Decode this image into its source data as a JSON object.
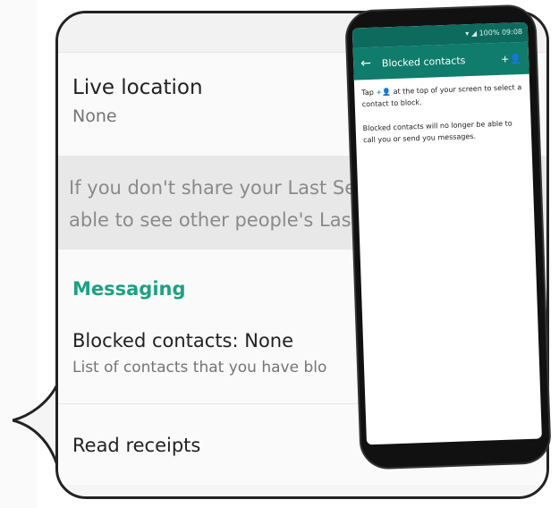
{
  "settings": {
    "live_location": {
      "title": "Live location",
      "value": "None"
    },
    "info_text": [
      "If you don't share your Last Se",
      "able to see other people's Las"
    ],
    "section_header": "Messaging",
    "blocked": {
      "title": "Blocked contacts: None",
      "subtitle": "List of contacts that you have blo"
    },
    "read_receipts": {
      "title": "Read receipts"
    }
  },
  "phone": {
    "status_text": "100%  09:08",
    "appbar": {
      "title": "Blocked contacts",
      "back_icon": "arrow-back-icon",
      "add_icon": "add-contact-icon"
    },
    "body": {
      "paragraph1_pre": "Tap",
      "paragraph1_post": "at the top of your screen to select a contact to block.",
      "paragraph2": "Blocked contacts will no longer be able to call you or send you messages."
    }
  },
  "colors": {
    "accent": "#1ea084",
    "appbar": "#0f7c6c",
    "status": "#0d6b5e"
  }
}
